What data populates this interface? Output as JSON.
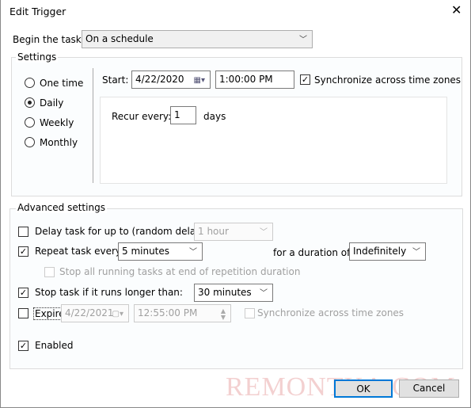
{
  "window": {
    "title": "Edit Trigger",
    "close_icon": "close-icon"
  },
  "begin": {
    "label": "Begin the task:",
    "value": "On a schedule"
  },
  "settings": {
    "legend": "Settings",
    "schedule_options": [
      {
        "label": "One time",
        "selected": false
      },
      {
        "label": "Daily",
        "selected": true
      },
      {
        "label": "Weekly",
        "selected": false
      },
      {
        "label": "Monthly",
        "selected": false
      }
    ],
    "start_label": "Start:",
    "start_date": "4/22/2020",
    "start_time": "1:00:00 PM",
    "sync_label": "Synchronize across time zones",
    "sync_checked": true,
    "recur_label": "Recur every:",
    "recur_value": "1",
    "recur_unit": "days"
  },
  "advanced": {
    "legend": "Advanced settings",
    "delay": {
      "label": "Delay task for up to (random delay):",
      "checked": false,
      "value": "1 hour"
    },
    "repeat": {
      "label": "Repeat task every:",
      "checked": true,
      "value": "5 minutes",
      "duration_label": "for a duration of:",
      "duration_value": "Indefinitely"
    },
    "stop_all": {
      "label": "Stop all running tasks at end of repetition duration",
      "checked": false
    },
    "stop_long": {
      "label": "Stop task if it runs longer than:",
      "checked": true,
      "value": "30 minutes"
    },
    "expire": {
      "label": "Expire:",
      "checked": false,
      "date": "4/22/2021",
      "time": "12:55:00 PM",
      "sync_label": "Synchronize across time zones"
    },
    "enabled": {
      "label": "Enabled",
      "checked": true
    }
  },
  "buttons": {
    "ok": "OK",
    "cancel": "Cancel"
  },
  "watermark": "REMONTKA.COM",
  "colors": {
    "accent": "#0078d7"
  }
}
